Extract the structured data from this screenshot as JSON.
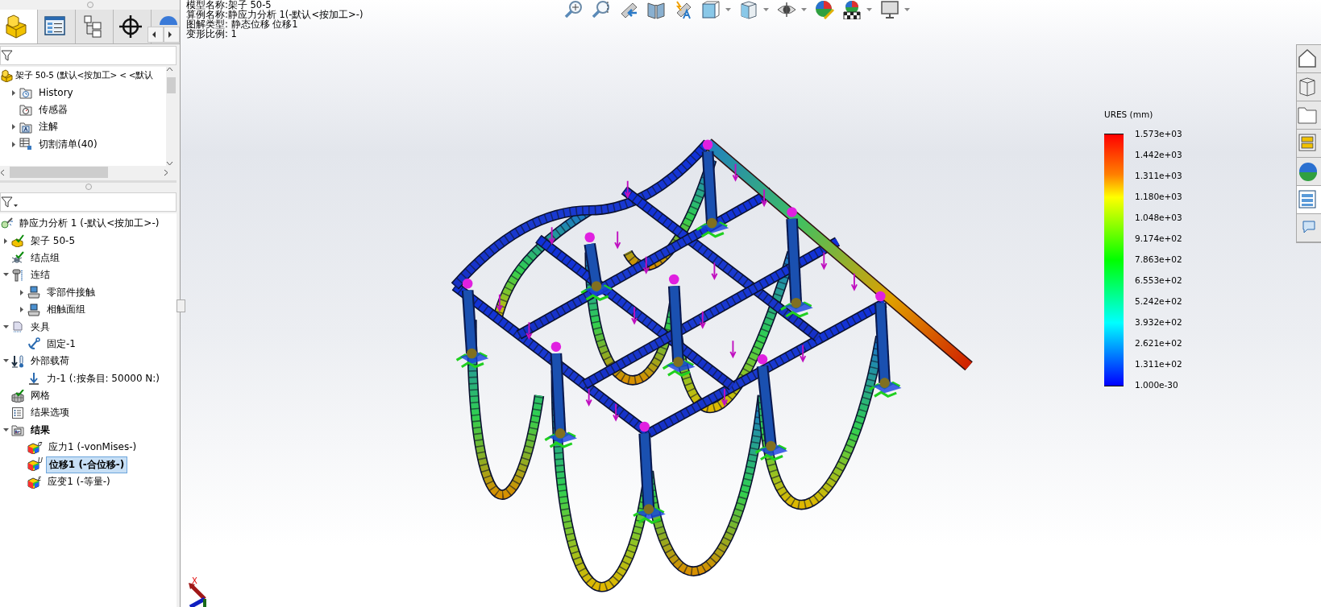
{
  "panel_tabs": [
    {
      "kind": "feature",
      "selected": true
    },
    {
      "kind": "property",
      "selected": false
    },
    {
      "kind": "config",
      "selected": false
    },
    {
      "kind": "target",
      "selected": false
    },
    {
      "kind": "display",
      "selected": false
    }
  ],
  "feature_tree": {
    "root": {
      "label": "架子 50-5  (默认<按加工> < <默认",
      "kind": "part",
      "selected": false
    },
    "items": [
      {
        "label": "History",
        "kind": "history",
        "expanded": false,
        "selected": false
      },
      {
        "label": "传感器",
        "kind": "sensor",
        "selected": false
      },
      {
        "label": "注解",
        "kind": "annotation",
        "expanded": false,
        "selected": false
      },
      {
        "label": "切割清单(40)",
        "kind": "cutlist",
        "expanded": false,
        "selected": false
      }
    ]
  },
  "study_tree": {
    "root": {
      "label": "静应力分析 1 (-默认<按加工>-)",
      "kind": "study",
      "selected": false
    },
    "items": [
      {
        "label": "架子 50-5",
        "kind": "part-check",
        "expanded": false,
        "selected": false
      },
      {
        "label": "结点组",
        "kind": "joints",
        "selected": false
      },
      {
        "label": "连结",
        "kind": "connections",
        "expanded": true,
        "selected": false,
        "children": [
          {
            "label": "零部件接触",
            "kind": "contact",
            "expanded": false,
            "selected": false
          },
          {
            "label": "相触面组",
            "kind": "contact",
            "expanded": false,
            "selected": false
          }
        ]
      },
      {
        "label": "夹具",
        "kind": "fixtures",
        "expanded": true,
        "selected": false,
        "children": [
          {
            "label": "固定-1",
            "kind": "anchor",
            "selected": false
          }
        ]
      },
      {
        "label": "外部载荷",
        "kind": "loads",
        "expanded": true,
        "selected": false,
        "children": [
          {
            "label": "力-1 (:按条目: 50000 N:)",
            "kind": "force",
            "selected": false
          }
        ]
      },
      {
        "label": "网格",
        "kind": "mesh",
        "selected": false
      },
      {
        "label": "结果选项",
        "kind": "options",
        "selected": false
      },
      {
        "label": "结果",
        "kind": "results",
        "expanded": true,
        "selected": false,
        "bold": true,
        "children": [
          {
            "label": "应力1 (-vonMises-)",
            "kind": "plot",
            "symbol": "σ",
            "selected": false
          },
          {
            "label": "位移1 (-合位移-)",
            "kind": "plot",
            "symbol": "U",
            "selected": true
          },
          {
            "label": "应变1 (-等量-)",
            "kind": "plot",
            "symbol": "ε",
            "selected": false
          }
        ]
      }
    ]
  },
  "header_info": [
    "模型名称:架子 50-5",
    "算例名称:静应力分析 1(-默认<按加工>-)",
    "图解类型: 静态位移 位移1",
    "变形比例: 1"
  ],
  "toolbar": [
    {
      "kind": "zoom-fit",
      "menu": false
    },
    {
      "kind": "zoom-area",
      "menu": false
    },
    {
      "kind": "previous-view",
      "menu": false
    },
    {
      "kind": "section-view",
      "menu": false
    },
    {
      "kind": "dynamic-annotation",
      "menu": false
    },
    {
      "kind": "view-orientation",
      "menu": true
    },
    {
      "kind": "display-style",
      "menu": true
    },
    {
      "kind": "hide-show",
      "menu": true
    },
    {
      "kind": "edit-appearance",
      "menu": false
    },
    {
      "kind": "scene",
      "menu": true
    },
    {
      "kind": "view-settings",
      "menu": true
    }
  ],
  "legend": {
    "title": "URES (mm)",
    "labels": [
      "1.573e+03",
      "1.442e+03",
      "1.311e+03",
      "1.180e+03",
      "1.048e+03",
      "9.174e+02",
      "7.863e+02",
      "6.553e+02",
      "5.242e+02",
      "3.932e+02",
      "2.621e+02",
      "1.311e+02",
      "1.000e-30"
    ]
  },
  "triad": {
    "x_label": "X"
  },
  "task_pane": [
    {
      "kind": "home",
      "selected": false
    },
    {
      "kind": "parts",
      "selected": false
    },
    {
      "kind": "folder",
      "selected": false
    },
    {
      "kind": "palette",
      "selected": false
    },
    {
      "kind": "appearance",
      "selected": false
    },
    {
      "kind": "properties",
      "selected": true
    },
    {
      "kind": "forum",
      "selected": false
    }
  ]
}
